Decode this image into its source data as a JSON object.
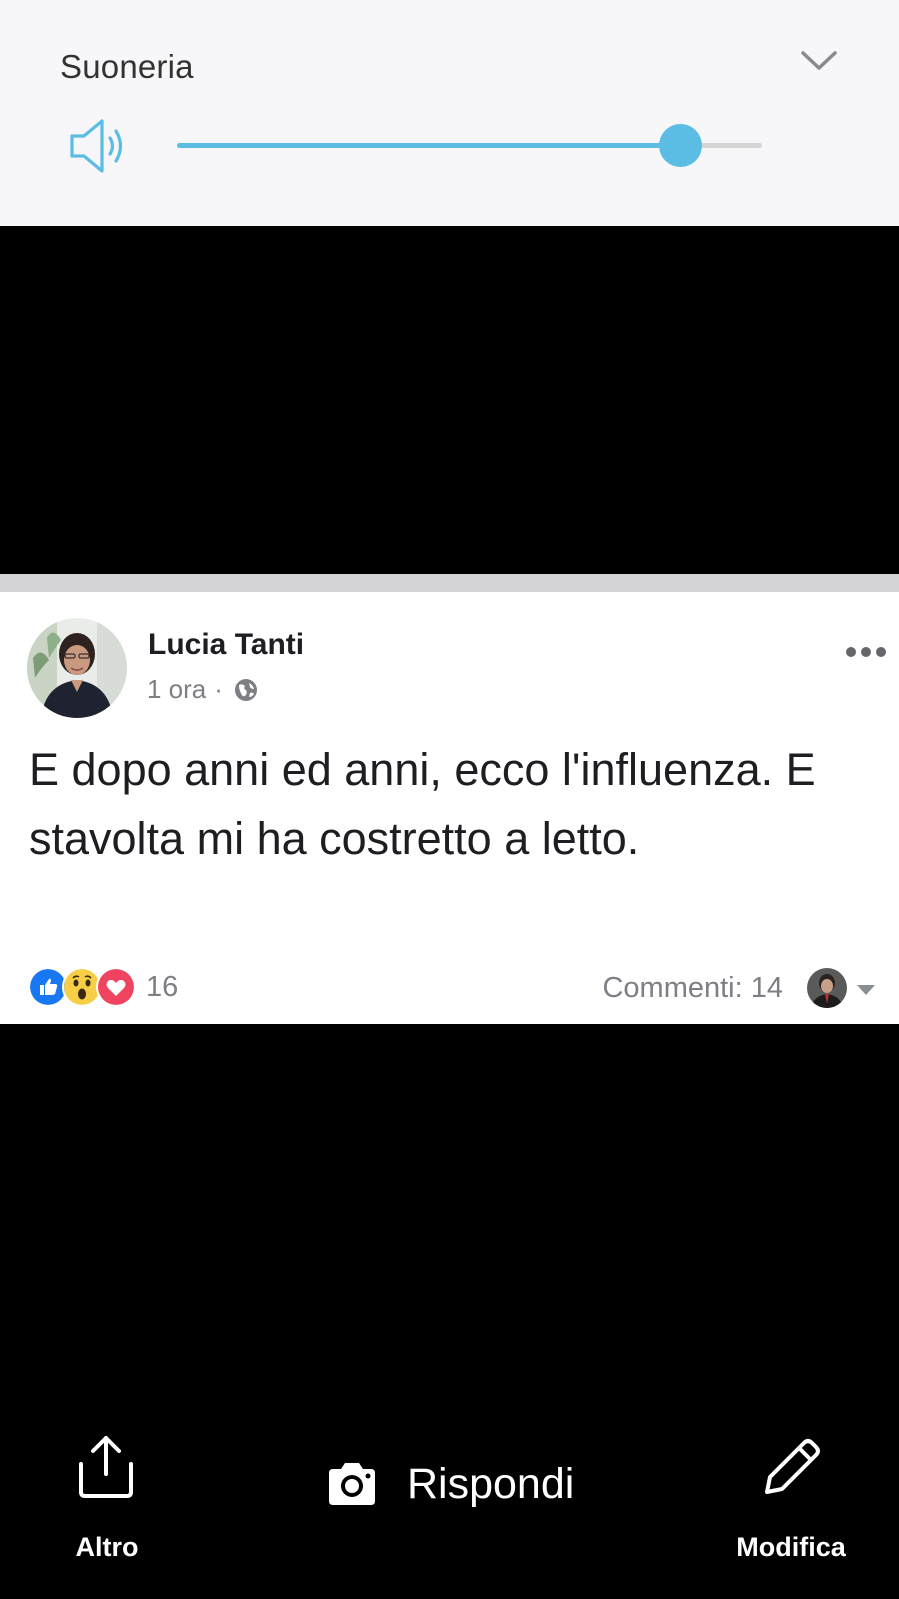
{
  "volume": {
    "title": "Suoneria",
    "level": 0.86,
    "accent_color": "#5bbde3",
    "icons": {
      "speaker": "speaker-icon",
      "collapse": "chevron-down-icon"
    }
  },
  "post": {
    "author": "Lucia Tanti",
    "time": "1 ora",
    "separator": "·",
    "audience_icon": "globe-icon",
    "text": "E dopo anni ed anni, ecco l'influenza. E stavolta mi ha costretto a letto.",
    "reactions": {
      "types": [
        "like",
        "wow",
        "love"
      ],
      "count": "16"
    },
    "comments": "Commenti: 14"
  },
  "actions": {
    "share_label": "Altro",
    "reply_label": "Rispondi",
    "edit_label": "Modifica"
  }
}
